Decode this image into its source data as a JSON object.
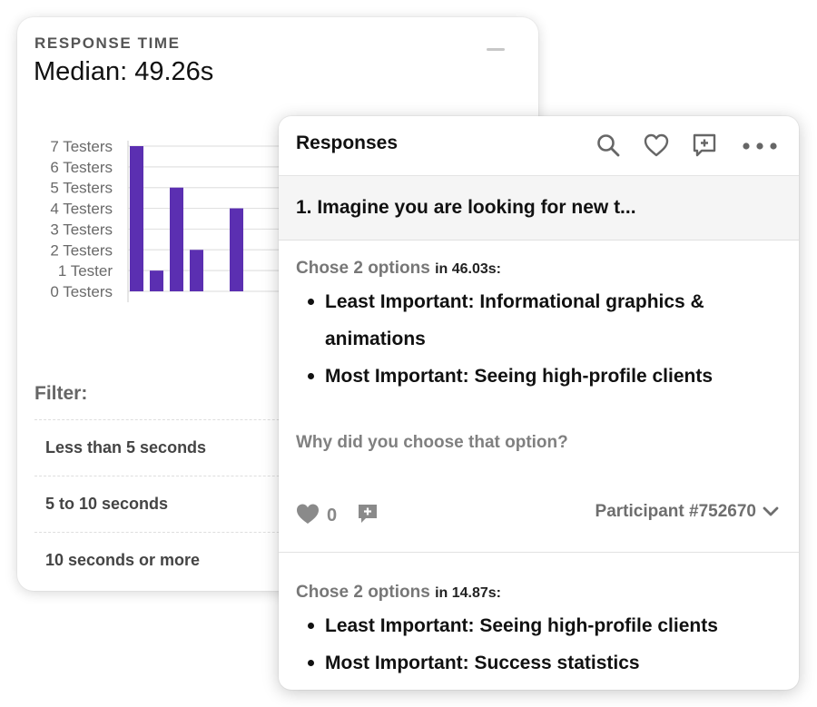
{
  "response_time": {
    "title": "RESPONSE TIME",
    "median": "Median: 49.26s"
  },
  "chart_data": {
    "type": "bar",
    "title": "",
    "xlabel": "",
    "ylabel": "",
    "ylim": [
      0,
      7
    ],
    "y_tick_labels": [
      "0 Testers",
      "1 Tester",
      "2 Testers",
      "3 Testers",
      "4 Testers",
      "5 Testers",
      "6 Testers",
      "7 Testers"
    ],
    "values": [
      7,
      1,
      5,
      2,
      0,
      4
    ],
    "grid": true,
    "bar_color": "#5b2fb1"
  },
  "filter": {
    "label": "Filter:",
    "items": [
      "Less than 5 seconds",
      "5 to 10 seconds",
      "10 seconds or more"
    ]
  },
  "responses": {
    "title": "Responses",
    "icons": [
      "search-icon",
      "heart-icon",
      "add-comment-icon",
      "more-icon"
    ],
    "question": "1. Imagine you are looking for new t...",
    "items": [
      {
        "meta": "Chose 2 options",
        "time": "in 46.03s:",
        "bullets": [
          "Least Important: Informational graphics & animations",
          "Most Important: Seeing high-profile clients"
        ],
        "followup": "Why did you choose that option?",
        "likes": "0",
        "participant": "Participant #752670"
      },
      {
        "meta": "Chose 2 options",
        "time": "in 14.87s:",
        "bullets": [
          "Least Important: Seeing high-profile clients",
          "Most Important: Success statistics"
        ]
      }
    ]
  }
}
